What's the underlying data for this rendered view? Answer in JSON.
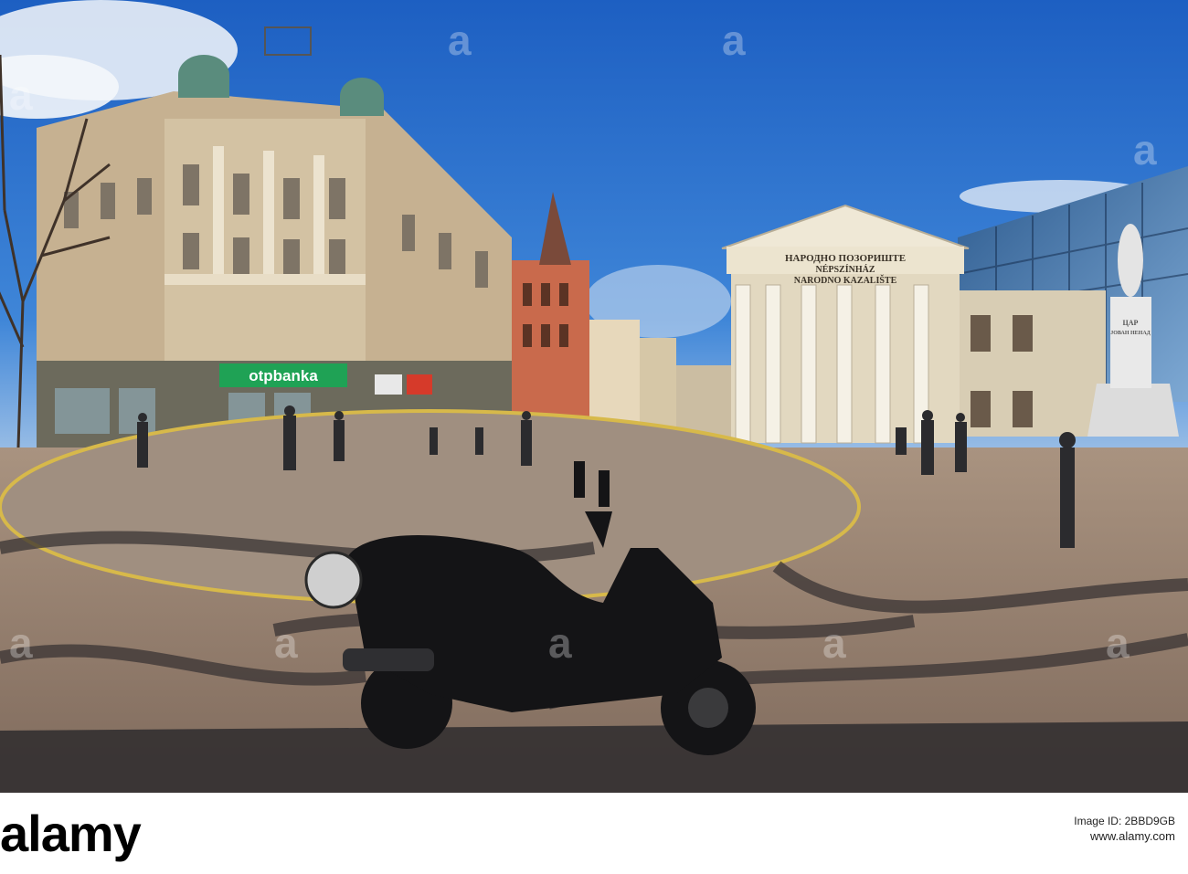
{
  "photo": {
    "description_free": true,
    "bank_sign": "otpbanka",
    "theatre_inscription": [
      "НАРОДНО ПОЗОРИШТЕ",
      "NÉPSZÍNHÁZ",
      "NARODNO KAZALIŠTE"
    ],
    "monument_inscription": [
      "ЦАР",
      "ЈОВАН НЕНАД"
    ],
    "colors": {
      "sky": "#1f67c8",
      "sky_light": "#5d9ae0",
      "pavement": "#b29a86",
      "shadow": "#3c3a3b",
      "theatre": "#dcd3bd",
      "building_left": "#cbb79a",
      "bank_green": "#1fa255"
    }
  },
  "watermark": {
    "text": "a"
  },
  "footer": {
    "logo": "alamy",
    "label": "Image ID: 2BBD9GB",
    "image_id": "www.alamy.com"
  }
}
